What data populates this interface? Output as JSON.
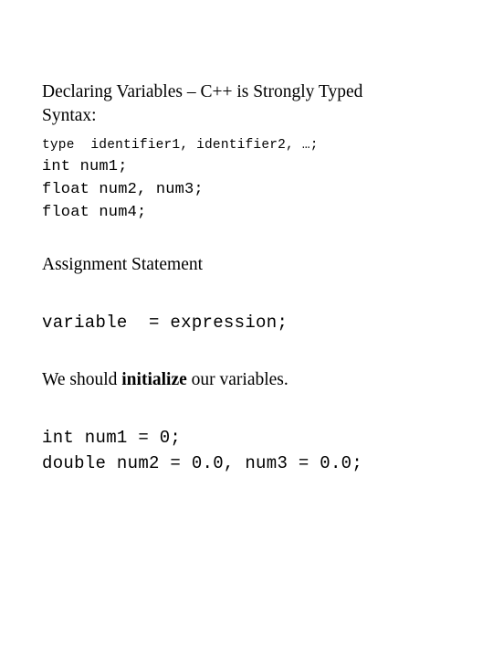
{
  "slide": {
    "heading": "Declaring Variables – C++ is Strongly Typed",
    "syntax_label": "Syntax:",
    "syntax_template": "type  identifier1, identifier2, …;",
    "declaration_lines": [
      "int num1;",
      "float num2, num3;",
      "float num4;"
    ],
    "assignment_heading": "Assignment Statement",
    "assignment_form": "variable  = expression;",
    "initialize_sentence": {
      "before": "We should ",
      "emphasis": "initialize",
      "after": " our variables."
    },
    "initialization_lines": [
      "int num1 = 0;",
      "double num2 = 0.0, num3 = 0.0;"
    ]
  }
}
